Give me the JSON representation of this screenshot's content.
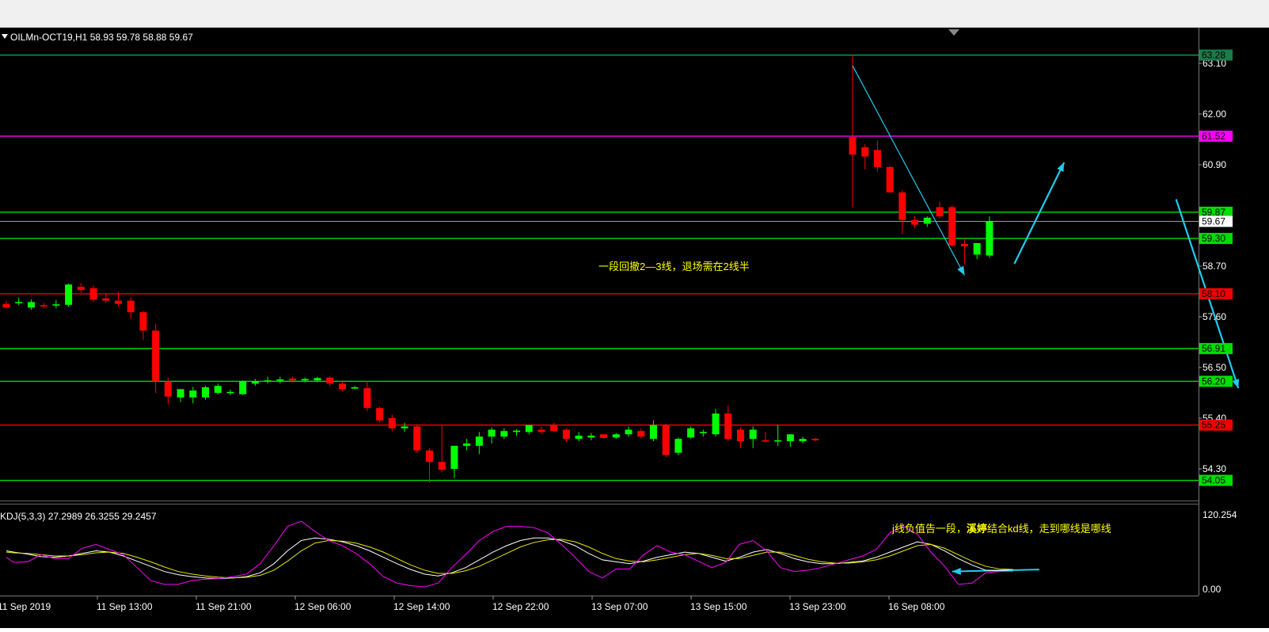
{
  "colors": {
    "background": "#000000",
    "bull_candle": "#00ff00",
    "bear_candle": "#ff0000",
    "green_line": "#00dd00",
    "red_line": "#ee0000",
    "magenta_line": "#ff00ff",
    "top_line": "#00aa55",
    "arrow": "#22ccee",
    "k_line": "#ffffff",
    "d_line": "#e6e600",
    "j_line": "#ff00ff",
    "annotation": "#ffff00",
    "axis_text": "#ffffff"
  },
  "header": {
    "menu_icon": "triangle-down-icon",
    "text": "OILMn-OCT19,H1  58.93 59.78 58.88 59.67"
  },
  "chart_data": [
    {
      "type": "candlestick",
      "symbol": "OILMn-OCT19",
      "timeframe": "H1",
      "ohlc_last": [
        58.93,
        59.78,
        58.88,
        59.67
      ],
      "ylim": [
        53.75,
        63.55
      ],
      "yticks": [
        "63.10",
        "62.00",
        "60.90",
        "58.70",
        "57.60",
        "56.50",
        "55.40",
        "54.30"
      ],
      "xticks": [
        "11 Sep 2019",
        "11 Sep 13:00",
        "11 Sep 21:00",
        "12 Sep 06:00",
        "12 Sep 14:00",
        "12 Sep 22:00",
        "13 Sep 07:00",
        "13 Sep 15:00",
        "13 Sep 23:00",
        "16 Sep 08:00"
      ],
      "current_price": "59.67",
      "candles": [
        {
          "o": 57.88,
          "h": 57.95,
          "l": 57.78,
          "c": 57.8
        },
        {
          "o": 57.9,
          "h": 58.02,
          "l": 57.85,
          "c": 57.92
        },
        {
          "o": 57.8,
          "h": 57.98,
          "l": 57.75,
          "c": 57.92
        },
        {
          "o": 57.85,
          "h": 57.9,
          "l": 57.78,
          "c": 57.83
        },
        {
          "o": 57.85,
          "h": 57.96,
          "l": 57.78,
          "c": 57.87
        },
        {
          "o": 57.86,
          "h": 58.32,
          "l": 57.82,
          "c": 58.3
        },
        {
          "o": 58.25,
          "h": 58.33,
          "l": 58.12,
          "c": 58.18
        },
        {
          "o": 58.22,
          "h": 58.28,
          "l": 57.92,
          "c": 57.97
        },
        {
          "o": 58.0,
          "h": 58.1,
          "l": 57.9,
          "c": 57.95
        },
        {
          "o": 57.95,
          "h": 58.15,
          "l": 57.82,
          "c": 57.88
        },
        {
          "o": 57.95,
          "h": 58.02,
          "l": 57.55,
          "c": 57.7
        },
        {
          "o": 57.7,
          "h": 57.72,
          "l": 57.1,
          "c": 57.3
        },
        {
          "o": 57.3,
          "h": 57.45,
          "l": 55.95,
          "c": 56.2
        },
        {
          "o": 56.2,
          "h": 56.28,
          "l": 55.7,
          "c": 55.87
        },
        {
          "o": 55.85,
          "h": 56.03,
          "l": 55.75,
          "c": 56.03
        },
        {
          "o": 55.85,
          "h": 56.08,
          "l": 55.72,
          "c": 56.0
        },
        {
          "o": 55.85,
          "h": 56.1,
          "l": 55.8,
          "c": 56.07
        },
        {
          "o": 55.95,
          "h": 56.15,
          "l": 55.92,
          "c": 56.1
        },
        {
          "o": 55.95,
          "h": 56.02,
          "l": 55.9,
          "c": 55.97
        },
        {
          "o": 55.92,
          "h": 56.22,
          "l": 55.9,
          "c": 56.2
        },
        {
          "o": 56.15,
          "h": 56.25,
          "l": 56.1,
          "c": 56.2
        },
        {
          "o": 56.2,
          "h": 56.3,
          "l": 56.15,
          "c": 56.22
        },
        {
          "o": 56.22,
          "h": 56.3,
          "l": 56.15,
          "c": 56.24
        },
        {
          "o": 56.26,
          "h": 56.3,
          "l": 56.2,
          "c": 56.22
        },
        {
          "o": 56.22,
          "h": 56.28,
          "l": 56.18,
          "c": 56.25
        },
        {
          "o": 56.22,
          "h": 56.3,
          "l": 56.18,
          "c": 56.27
        },
        {
          "o": 56.28,
          "h": 56.3,
          "l": 56.1,
          "c": 56.15
        },
        {
          "o": 56.15,
          "h": 56.2,
          "l": 55.98,
          "c": 56.03
        },
        {
          "o": 56.05,
          "h": 56.1,
          "l": 56.03,
          "c": 56.07
        },
        {
          "o": 56.05,
          "h": 56.2,
          "l": 55.55,
          "c": 55.62
        },
        {
          "o": 55.62,
          "h": 55.65,
          "l": 55.3,
          "c": 55.35
        },
        {
          "o": 55.4,
          "h": 55.48,
          "l": 55.12,
          "c": 55.18
        },
        {
          "o": 55.18,
          "h": 55.3,
          "l": 55.1,
          "c": 55.22
        },
        {
          "o": 55.22,
          "h": 55.25,
          "l": 54.65,
          "c": 54.7
        },
        {
          "o": 54.7,
          "h": 54.75,
          "l": 54.0,
          "c": 54.45
        },
        {
          "o": 54.45,
          "h": 55.25,
          "l": 54.22,
          "c": 54.28
        },
        {
          "o": 54.3,
          "h": 54.8,
          "l": 54.1,
          "c": 54.8
        },
        {
          "o": 54.8,
          "h": 54.95,
          "l": 54.7,
          "c": 54.85
        },
        {
          "o": 54.8,
          "h": 55.1,
          "l": 54.62,
          "c": 55.0
        },
        {
          "o": 55.0,
          "h": 55.2,
          "l": 54.85,
          "c": 55.15
        },
        {
          "o": 55.0,
          "h": 55.18,
          "l": 54.95,
          "c": 55.12
        },
        {
          "o": 55.1,
          "h": 55.16,
          "l": 55.02,
          "c": 55.13
        },
        {
          "o": 55.1,
          "h": 55.22,
          "l": 55.05,
          "c": 55.25
        },
        {
          "o": 55.15,
          "h": 55.22,
          "l": 55.05,
          "c": 55.1
        },
        {
          "o": 55.25,
          "h": 55.3,
          "l": 55.1,
          "c": 55.12
        },
        {
          "o": 55.15,
          "h": 55.18,
          "l": 54.88,
          "c": 54.95
        },
        {
          "o": 54.95,
          "h": 55.1,
          "l": 54.9,
          "c": 55.02
        },
        {
          "o": 54.98,
          "h": 55.08,
          "l": 54.92,
          "c": 55.02
        },
        {
          "o": 55.05,
          "h": 55.05,
          "l": 54.95,
          "c": 54.97
        },
        {
          "o": 54.98,
          "h": 55.08,
          "l": 54.95,
          "c": 55.05
        },
        {
          "o": 55.05,
          "h": 55.22,
          "l": 55.0,
          "c": 55.15
        },
        {
          "o": 55.12,
          "h": 55.18,
          "l": 54.96,
          "c": 55.0
        },
        {
          "o": 54.95,
          "h": 55.35,
          "l": 54.9,
          "c": 55.25
        },
        {
          "o": 55.25,
          "h": 55.28,
          "l": 54.55,
          "c": 54.6
        },
        {
          "o": 54.65,
          "h": 54.98,
          "l": 54.6,
          "c": 54.95
        },
        {
          "o": 54.98,
          "h": 55.22,
          "l": 54.95,
          "c": 55.18
        },
        {
          "o": 55.1,
          "h": 55.15,
          "l": 55.0,
          "c": 55.1
        },
        {
          "o": 55.05,
          "h": 55.6,
          "l": 55.0,
          "c": 55.5
        },
        {
          "o": 55.5,
          "h": 55.68,
          "l": 54.9,
          "c": 54.95
        },
        {
          "o": 55.15,
          "h": 55.2,
          "l": 54.75,
          "c": 54.9
        },
        {
          "o": 54.95,
          "h": 55.22,
          "l": 54.75,
          "c": 55.15
        },
        {
          "o": 54.92,
          "h": 55.1,
          "l": 54.88,
          "c": 54.9
        },
        {
          "o": 54.9,
          "h": 55.25,
          "l": 54.8,
          "c": 54.92
        },
        {
          "o": 54.9,
          "h": 55.0,
          "l": 54.78,
          "c": 55.05
        },
        {
          "o": 54.9,
          "h": 55.0,
          "l": 54.85,
          "c": 54.95
        },
        {
          "o": 54.95,
          "h": 54.98,
          "l": 54.9,
          "c": 54.92
        },
        null,
        null,
        {
          "o": 61.5,
          "h": 63.28,
          "l": 59.98,
          "c": 61.12
        },
        {
          "o": 61.28,
          "h": 61.35,
          "l": 60.8,
          "c": 61.08
        },
        {
          "o": 61.22,
          "h": 61.42,
          "l": 60.75,
          "c": 60.85
        },
        {
          "o": 60.85,
          "h": 60.88,
          "l": 60.3,
          "c": 60.3
        },
        {
          "o": 60.3,
          "h": 60.35,
          "l": 59.4,
          "c": 59.7
        },
        {
          "o": 59.7,
          "h": 59.78,
          "l": 59.52,
          "c": 59.6
        },
        {
          "o": 59.62,
          "h": 59.78,
          "l": 59.55,
          "c": 59.75
        },
        {
          "o": 59.98,
          "h": 60.1,
          "l": 59.73,
          "c": 59.78
        },
        {
          "o": 59.98,
          "h": 60.02,
          "l": 59.12,
          "c": 59.15
        },
        {
          "o": 59.18,
          "h": 59.3,
          "l": 58.73,
          "c": 59.13
        },
        {
          "o": 58.95,
          "h": 59.2,
          "l": 58.85,
          "c": 59.2
        },
        {
          "o": 58.93,
          "h": 59.78,
          "l": 58.88,
          "c": 59.67
        }
      ],
      "hlines": [
        {
          "price": 63.28,
          "label": "63.28",
          "kind": "top"
        },
        {
          "price": 61.52,
          "label": "61.52",
          "kind": "magenta"
        },
        {
          "price": 59.87,
          "label": "59.87",
          "kind": "green"
        },
        {
          "price": 59.3,
          "label": "59.30",
          "kind": "green"
        },
        {
          "price": 58.1,
          "label": "58.10",
          "kind": "red"
        },
        {
          "price": 56.91,
          "label": "56.91",
          "kind": "green"
        },
        {
          "price": 56.2,
          "label": "56.20",
          "kind": "green"
        },
        {
          "price": 55.25,
          "label": "55.25",
          "kind": "red"
        },
        {
          "price": 54.05,
          "label": "54.05",
          "kind": "green"
        }
      ],
      "arrows": [
        {
          "from": {
            "bar": 68,
            "price": 63.05
          },
          "to": {
            "bar": 77,
            "price": 58.5
          },
          "width": 1.2
        },
        {
          "from": {
            "bar": 81,
            "price": 58.75
          },
          "to": {
            "bar": 85,
            "price": 60.95
          },
          "width": 2.2
        },
        {
          "from": {
            "bar": 94,
            "price": 60.15
          },
          "to": {
            "bar": 99,
            "price": 56.05
          },
          "width": 2.2
        }
      ],
      "annotation": "一段回撤2—3线，退场需在2线半"
    },
    {
      "type": "line",
      "indicator": "KDJ(5,3,3)",
      "values_text": "27.2989 26.3255 29.2457",
      "ylim": [
        0,
        120.254
      ],
      "yticks": [
        "120.254",
        "0.00"
      ],
      "series": [
        {
          "name": "K",
          "values": [
            62,
            60,
            57,
            53,
            52,
            54,
            58,
            62,
            60,
            54,
            46,
            38,
            30,
            25,
            22,
            20,
            19,
            20,
            22,
            28,
            42,
            62,
            78,
            82,
            80,
            76,
            70,
            62,
            52,
            42,
            33,
            26,
            23,
            28,
            36,
            48,
            60,
            70,
            78,
            82,
            82,
            78,
            70,
            58,
            48,
            45,
            42,
            46,
            52,
            56,
            60,
            58,
            52,
            46,
            52,
            60,
            64,
            58,
            50,
            45,
            42,
            42,
            44,
            46,
            52,
            60,
            68,
            76,
            72,
            62,
            50,
            40,
            32,
            31,
            33
          ]
        },
        {
          "name": "D",
          "values": [
            60,
            59,
            58,
            56,
            54,
            54,
            56,
            59,
            60,
            58,
            52,
            45,
            37,
            30,
            26,
            23,
            21,
            20,
            21,
            24,
            32,
            46,
            62,
            74,
            78,
            77,
            74,
            68,
            60,
            50,
            40,
            32,
            27,
            27,
            31,
            38,
            48,
            58,
            68,
            75,
            79,
            80,
            76,
            68,
            58,
            50,
            46,
            45,
            48,
            52,
            56,
            58,
            55,
            50,
            50,
            55,
            60,
            60,
            55,
            49,
            45,
            43,
            43,
            45,
            48,
            54,
            62,
            70,
            72,
            66,
            56,
            46,
            38,
            34,
            33
          ]
        },
        {
          "name": "J",
          "values": [
            52,
            44,
            45,
            56,
            50,
            50,
            66,
            72,
            64,
            56,
            36,
            16,
            10,
            10,
            16,
            18,
            19,
            22,
            26,
            42,
            70,
            100,
            108,
            92,
            78,
            70,
            58,
            42,
            22,
            12,
            8,
            6,
            12,
            36,
            56,
            78,
            92,
            100,
            100,
            98,
            90,
            72,
            52,
            30,
            20,
            34,
            34,
            56,
            70,
            60,
            56,
            46,
            36,
            44,
            72,
            78,
            62,
            36,
            30,
            32,
            36,
            42,
            48,
            54,
            64,
            90,
            100,
            88,
            60,
            38,
            10,
            12,
            28,
            30,
            30
          ]
        }
      ],
      "arrows": [
        {
          "from": {
            "bar": 83,
            "kval": 33
          },
          "to": {
            "bar": 76,
            "kval": 30
          },
          "width": 2
        }
      ],
      "annotation_prefix": "j线负值告一段，",
      "annotation_bold": "溪婷",
      "annotation_suffix": "结合kd线，走到哪线是哪线"
    }
  ]
}
